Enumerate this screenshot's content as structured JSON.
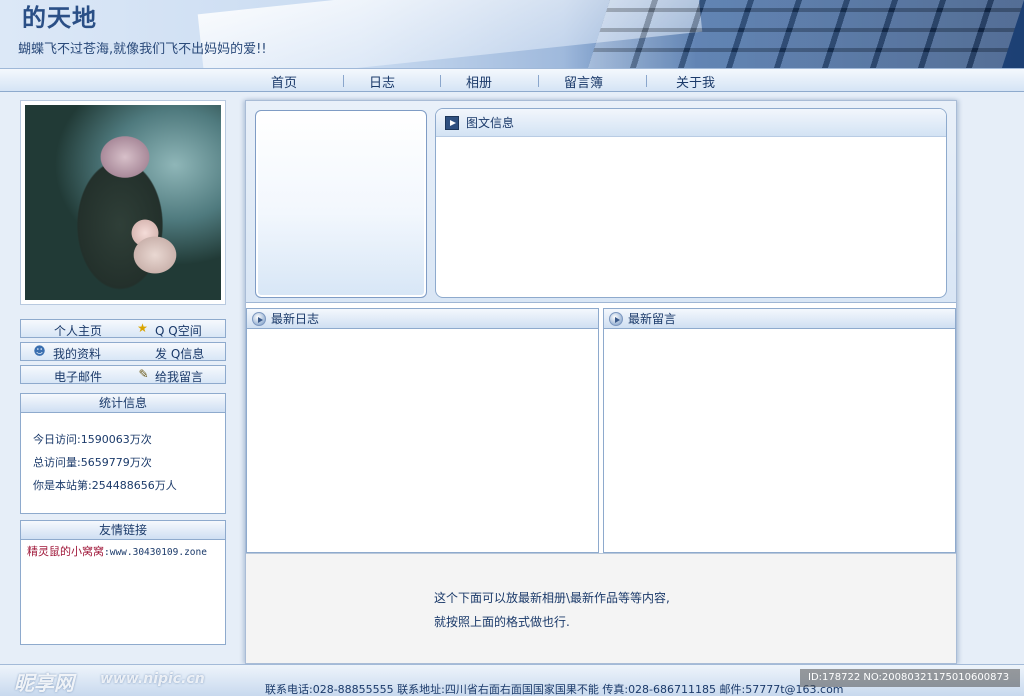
{
  "header": {
    "site_title": "的天地",
    "slogan": "蝴蝶飞不过苍海,就像我们飞不出妈妈的爱!!"
  },
  "nav": {
    "items": [
      "首页",
      "日志",
      "相册",
      "留言簿",
      "关于我"
    ]
  },
  "sidebar": {
    "quick_links": [
      {
        "left": "个人主页",
        "right": "Q  Q空间",
        "right_icon": "star-icon"
      },
      {
        "left": "我的资料",
        "left_icon": "user-icon",
        "right": "发 Q信息"
      },
      {
        "left": "电子邮件",
        "right": "给我留言",
        "right_icon": "note-icon"
      }
    ],
    "stats": {
      "title": "统计信息",
      "lines": [
        "今日访问:1590063万次",
        "总访问量:5659779万次",
        "你是本站第:254488656万人"
      ]
    },
    "friends": {
      "title": "友情链接",
      "items": [
        {
          "name": "精灵鼠的小窝窝",
          "url": ":www.30430109.zone"
        }
      ]
    }
  },
  "main": {
    "news_title": "图文信息",
    "latest_blog_title": "最新日志",
    "latest_message_title": "最新留言",
    "note_line1": "这个下面可以放最新相册\\最新作品等等内容,",
    "note_line2": "就按照上面的格式做也行."
  },
  "footer": {
    "contact": "联系电话:028-88855555 联系地址:四川省右面右面国国家国果不能  传真:028-686711185 邮件:57777t@163.com"
  },
  "watermark": {
    "logo": "昵享网",
    "url": "www.nipic.cn",
    "id": "ID:178722 NO:20080321175010600873"
  },
  "colors": {
    "accent": "#1b3a6a",
    "border": "#8eaacd",
    "friend_name": "#a0183a"
  }
}
